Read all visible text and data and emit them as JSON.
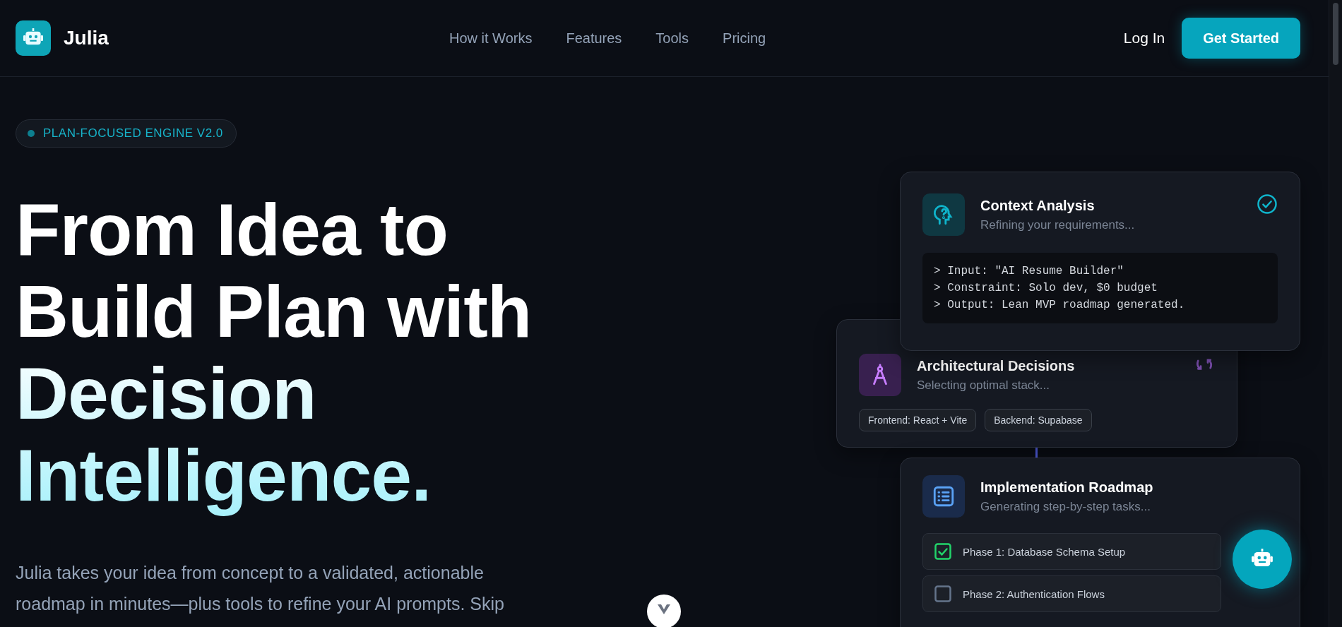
{
  "header": {
    "brand": "Julia",
    "nav": [
      {
        "label": "How it Works"
      },
      {
        "label": "Features"
      },
      {
        "label": "Tools"
      },
      {
        "label": "Pricing"
      }
    ],
    "login": "Log In",
    "cta": "Get Started"
  },
  "hero": {
    "badge": "PLAN-FOCUSED ENGINE V2.0",
    "headline": "From Idea to Build Plan with Decision Intelligence.",
    "description": "Julia takes your idea from concept to a validated, actionable roadmap in minutes—plus tools to refine your AI prompts. Skip"
  },
  "cards": [
    {
      "kind": "analysis",
      "title": "Context Analysis",
      "subtitle": "Refining your requirements...",
      "completed": true,
      "console": [
        "> Input: \"AI Resume Builder\"",
        "> Constraint: Solo dev, $0 budget",
        "> Output: Lean MVP roadmap generated."
      ]
    },
    {
      "kind": "decisions",
      "title": "Architectural Decisions",
      "subtitle": "Selecting optimal stack...",
      "completed": false,
      "tags": [
        "Frontend: React + Vite",
        "Backend: Supabase"
      ]
    },
    {
      "kind": "roadmap",
      "title": "Implementation Roadmap",
      "subtitle": "Generating step-by-step tasks...",
      "tasks": [
        {
          "label": "Phase 1: Database Schema Setup",
          "checked": true
        },
        {
          "label": "Phase 2: Authentication Flows",
          "checked": false
        }
      ]
    }
  ]
}
